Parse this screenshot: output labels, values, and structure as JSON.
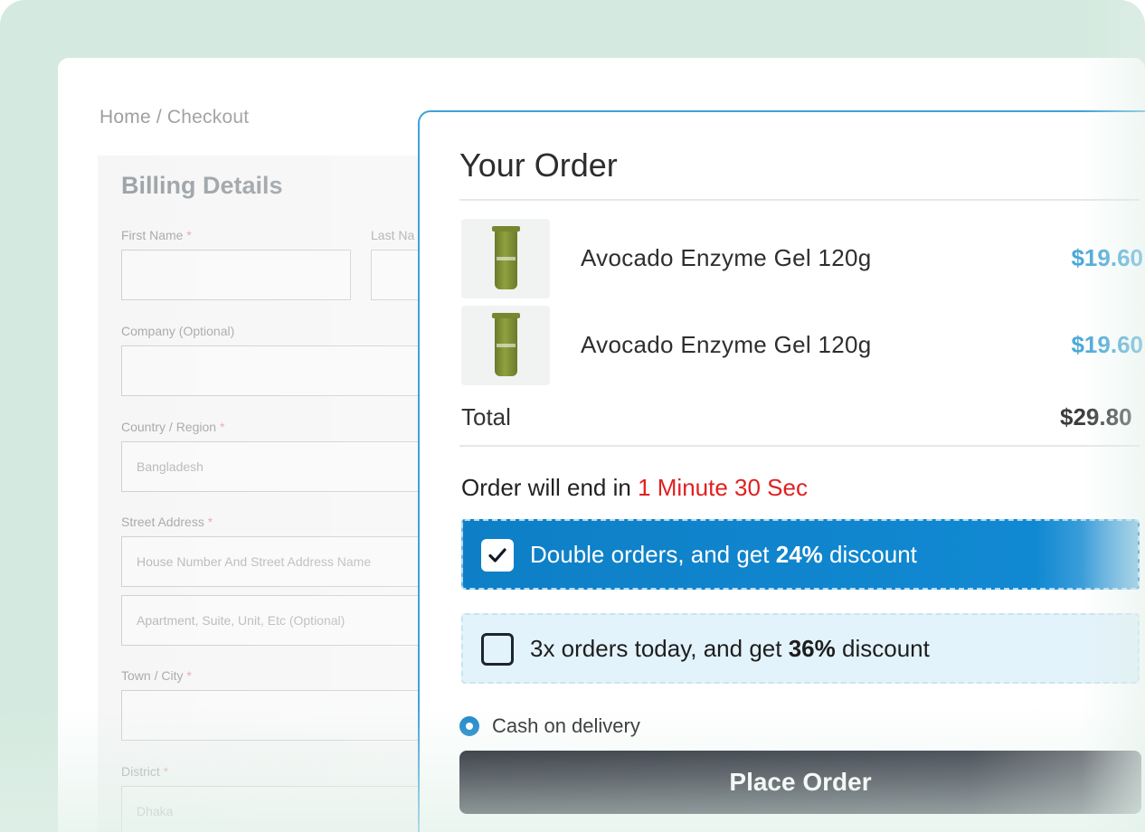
{
  "breadcrumb": "Home / Checkout",
  "billing": {
    "title": "Billing Details",
    "fields": {
      "first_name": {
        "label": "First Name",
        "required": "*",
        "value": ""
      },
      "last_name": {
        "label": "Last Na",
        "required": "",
        "value": ""
      },
      "company": {
        "label": "Company (Optional)",
        "value": ""
      },
      "country": {
        "label": "Country / Region",
        "required": "*",
        "value": "Bangladesh"
      },
      "street": {
        "label": "Street Address",
        "required": "*",
        "placeholder": "House Number And Street Address Name"
      },
      "apartment": {
        "placeholder": "Apartment, Suite, Unit, Etc (Optional)"
      },
      "city": {
        "label": "Town / City",
        "required": "*",
        "value": ""
      },
      "district": {
        "label": "District",
        "required": "*",
        "value": "Dhaka"
      }
    }
  },
  "order": {
    "title": "Your Order",
    "items": [
      {
        "name": "Avocado Enzyme Gel 120g",
        "price": "$19.60",
        "icon": "product-tube-icon"
      },
      {
        "name": "Avocado Enzyme Gel 120g",
        "price": "$19.60",
        "icon": "product-tube-icon"
      }
    ],
    "total_label": "Total",
    "total_value": "$29.80",
    "timer_prefix": "Order will end in",
    "timer_value": "1 Minute 30 Sec",
    "offers": [
      {
        "prefix": "Double orders, and get",
        "discount": "24%",
        "suffix": "discount",
        "checked": true
      },
      {
        "prefix": "3x orders today, and get",
        "discount": "36%",
        "suffix": "discount",
        "checked": false
      }
    ],
    "payment_method": "Cash on delivery",
    "place_order_label": "Place Order"
  },
  "colors": {
    "accent": "#1189d2",
    "price": "#4ba8d8",
    "timer": "#e02020",
    "background": "#d4e9df",
    "button": "#0b0d1a"
  }
}
